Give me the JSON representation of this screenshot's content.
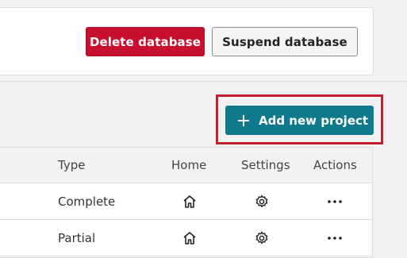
{
  "database_actions": {
    "delete_label": "Delete database",
    "suspend_label": "Suspend database"
  },
  "projects": {
    "add_label": "Add new project",
    "columns": {
      "type": "Type",
      "home": "Home",
      "settings": "Settings",
      "actions": "Actions"
    },
    "rows": [
      {
        "type": "Complete",
        "home_icon": "home-icon",
        "settings_icon": "gear-icon",
        "actions_icon": "more-icon"
      },
      {
        "type": "Partial",
        "home_icon": "home-icon",
        "settings_icon": "gear-icon",
        "actions_icon": "more-icon"
      }
    ]
  },
  "colors": {
    "danger": "#c8102e",
    "primary": "#0e7a8c",
    "highlight": "#c0202e"
  }
}
